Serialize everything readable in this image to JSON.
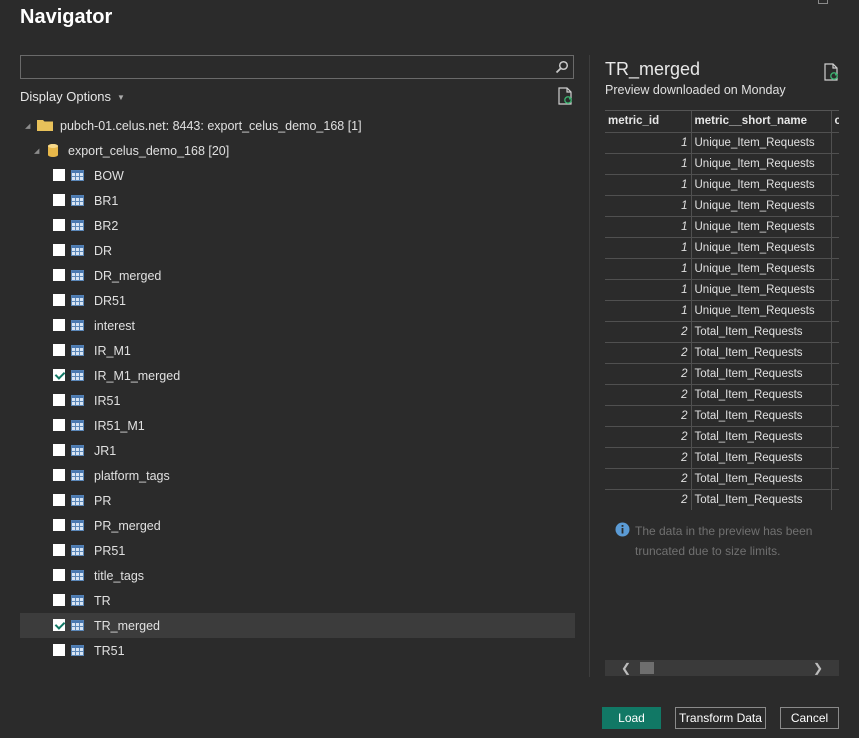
{
  "window": {
    "title": "Navigator"
  },
  "search": {
    "value": "",
    "placeholder": ""
  },
  "display_options": {
    "label": "Display Options"
  },
  "tree": {
    "server": {
      "label": "pubch-01.celus.net: 8443: export_celus_demo_168 [1]"
    },
    "database": {
      "label": "export_celus_demo_168 [20]"
    },
    "tables": [
      {
        "label": "BOW",
        "checked": false,
        "selected": false
      },
      {
        "label": "BR1",
        "checked": false,
        "selected": false
      },
      {
        "label": "BR2",
        "checked": false,
        "selected": false
      },
      {
        "label": "DR",
        "checked": false,
        "selected": false
      },
      {
        "label": "DR_merged",
        "checked": false,
        "selected": false
      },
      {
        "label": "DR51",
        "checked": false,
        "selected": false
      },
      {
        "label": "interest",
        "checked": false,
        "selected": false
      },
      {
        "label": "IR_M1",
        "checked": false,
        "selected": false
      },
      {
        "label": "IR_M1_merged",
        "checked": true,
        "selected": false
      },
      {
        "label": "IR51",
        "checked": false,
        "selected": false
      },
      {
        "label": "IR51_M1",
        "checked": false,
        "selected": false
      },
      {
        "label": "JR1",
        "checked": false,
        "selected": false
      },
      {
        "label": "platform_tags",
        "checked": false,
        "selected": false
      },
      {
        "label": "PR",
        "checked": false,
        "selected": false
      },
      {
        "label": "PR_merged",
        "checked": false,
        "selected": false
      },
      {
        "label": "PR51",
        "checked": false,
        "selected": false
      },
      {
        "label": "title_tags",
        "checked": false,
        "selected": false
      },
      {
        "label": "TR",
        "checked": false,
        "selected": false
      },
      {
        "label": "TR_merged",
        "checked": true,
        "selected": true
      },
      {
        "label": "TR51",
        "checked": false,
        "selected": false
      }
    ]
  },
  "preview": {
    "title": "TR_merged",
    "subtitle": "Preview downloaded on Monday",
    "columns": [
      "metric_id",
      "metric__short_name",
      "o"
    ],
    "rows": [
      [
        "1",
        "Unique_Item_Requests",
        ""
      ],
      [
        "1",
        "Unique_Item_Requests",
        ""
      ],
      [
        "1",
        "Unique_Item_Requests",
        ""
      ],
      [
        "1",
        "Unique_Item_Requests",
        ""
      ],
      [
        "1",
        "Unique_Item_Requests",
        ""
      ],
      [
        "1",
        "Unique_Item_Requests",
        ""
      ],
      [
        "1",
        "Unique_Item_Requests",
        ""
      ],
      [
        "1",
        "Unique_Item_Requests",
        ""
      ],
      [
        "1",
        "Unique_Item_Requests",
        ""
      ],
      [
        "2",
        "Total_Item_Requests",
        ""
      ],
      [
        "2",
        "Total_Item_Requests",
        ""
      ],
      [
        "2",
        "Total_Item_Requests",
        ""
      ],
      [
        "2",
        "Total_Item_Requests",
        ""
      ],
      [
        "2",
        "Total_Item_Requests",
        ""
      ],
      [
        "2",
        "Total_Item_Requests",
        ""
      ],
      [
        "2",
        "Total_Item_Requests",
        ""
      ],
      [
        "2",
        "Total_Item_Requests",
        ""
      ],
      [
        "2",
        "Total_Item_Requests",
        ""
      ]
    ],
    "truncation_note": "The data in the preview has been truncated due to size limits."
  },
  "buttons": {
    "load": "Load",
    "transform": "Transform Data",
    "cancel": "Cancel"
  },
  "colors": {
    "accent": "#117865",
    "background": "#2b2b2b",
    "info_icon": "#5b9bd5",
    "folder": "#e8c15a"
  }
}
